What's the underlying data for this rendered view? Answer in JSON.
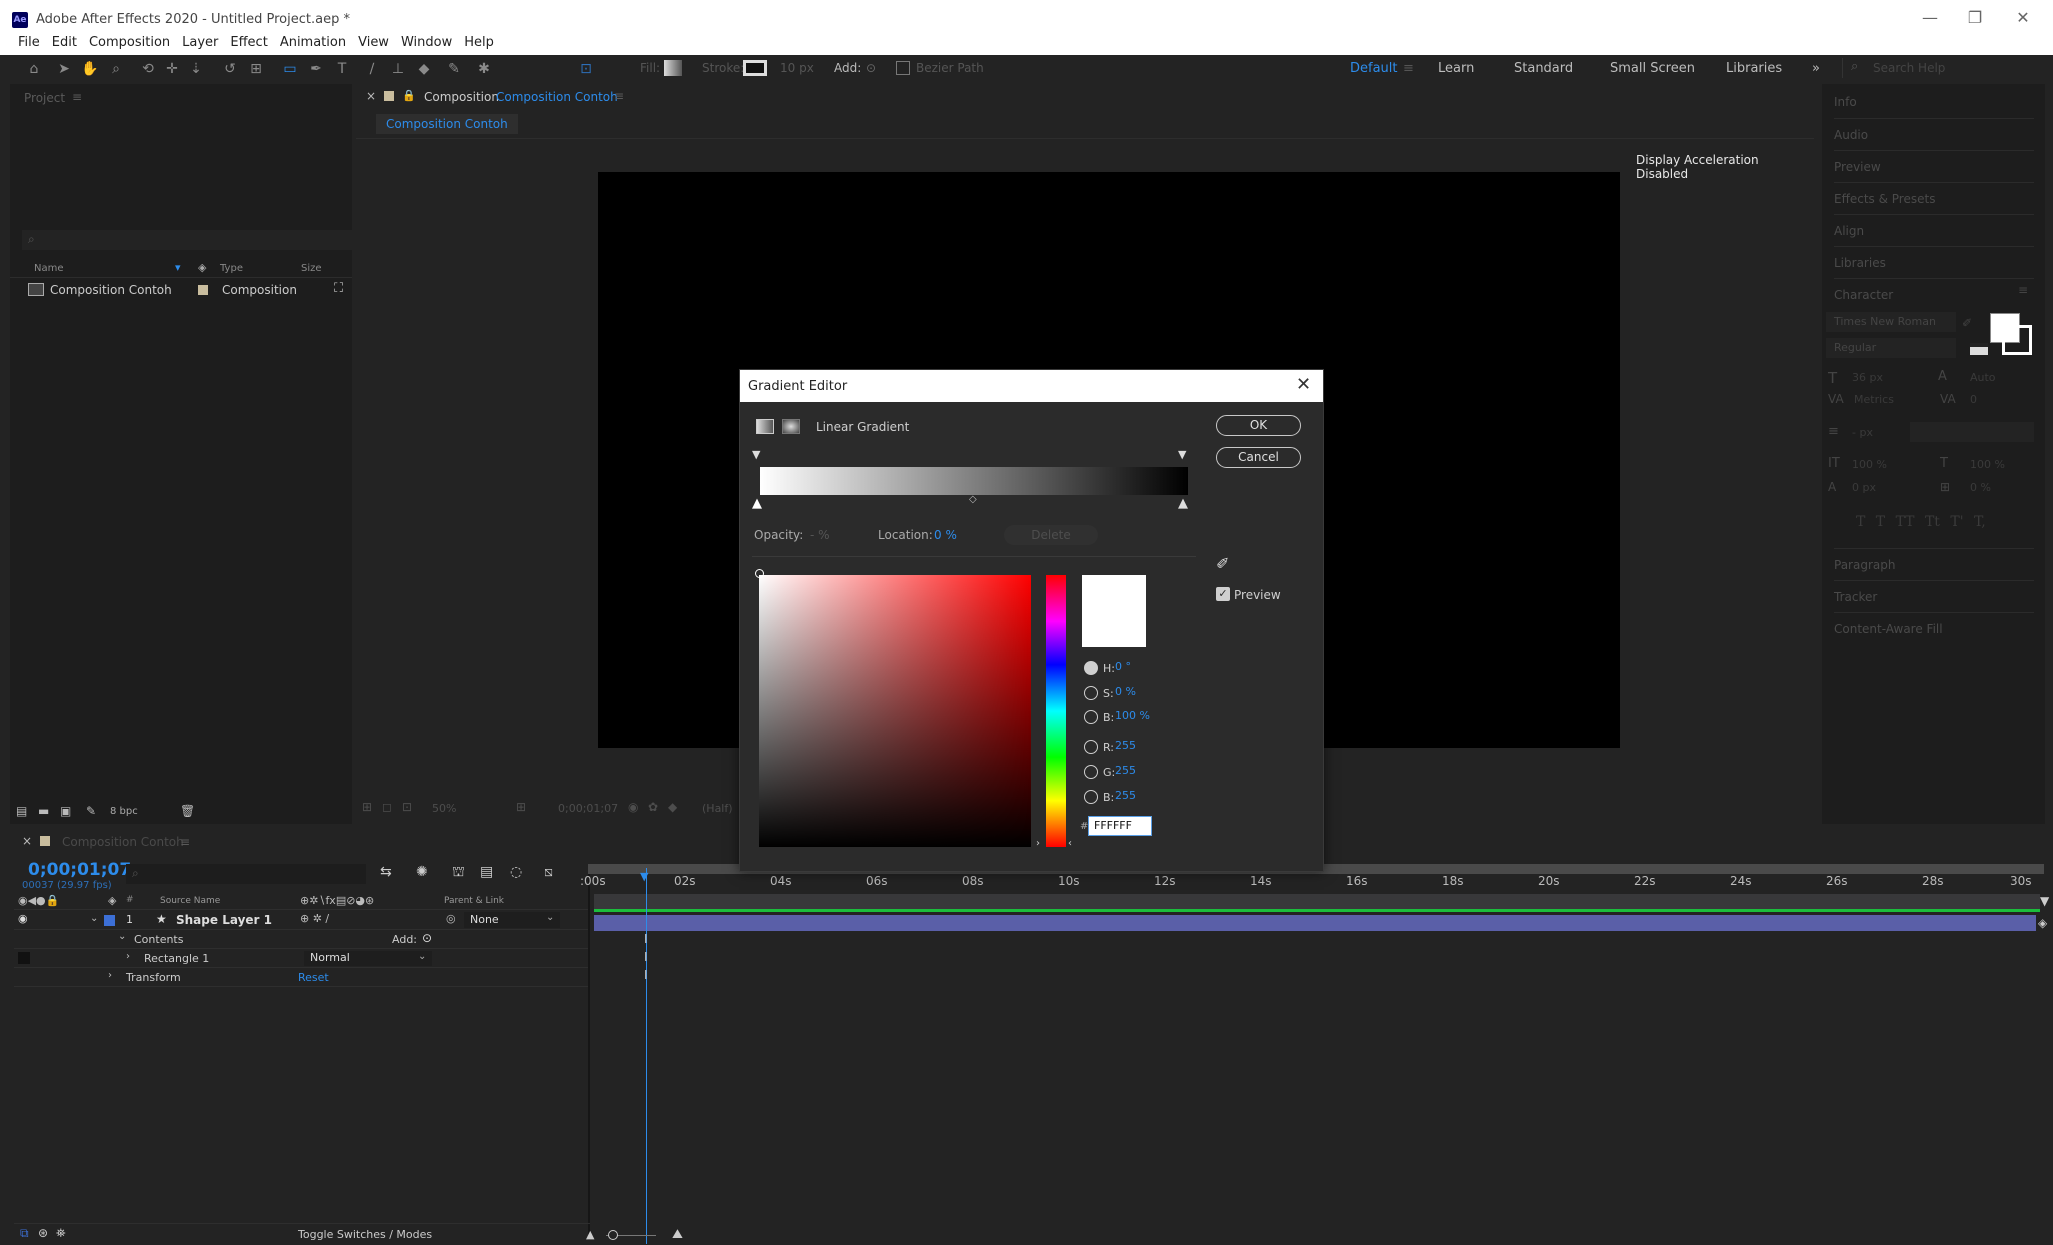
{
  "app": {
    "icon_text": "Ae",
    "title": "Adobe After Effects 2020 - Untitled Project.aep *"
  },
  "menu": [
    "File",
    "Edit",
    "Composition",
    "Layer",
    "Effect",
    "Animation",
    "View",
    "Window",
    "Help"
  ],
  "toolbar": {
    "fill_label": "Fill:",
    "stroke_label": "Stroke:",
    "stroke_width": "10 px",
    "add_label": "Add:",
    "bezier_label": "Bezier Path",
    "search_placeholder": "Search Help"
  },
  "workspaces": {
    "items": [
      "Default",
      "Learn",
      "Standard",
      "Small Screen",
      "Libraries"
    ],
    "active": "Default"
  },
  "project": {
    "title": "Project",
    "columns": [
      "Name",
      "Type",
      "Size"
    ],
    "item_name": "Composition Contoh",
    "item_type": "Composition",
    "bpc": "8 bpc"
  },
  "composition": {
    "tab_prefix": "Composition",
    "tab_name": "Composition Contoh",
    "subtab": "Composition Contoh",
    "notice": "Display Acceleration Disabled",
    "zoom": "50%",
    "timecode": "0;00;01;07",
    "resolution": "(Half)"
  },
  "right_panels": [
    "Info",
    "Audio",
    "Preview",
    "Effects & Presets",
    "Align",
    "Libraries",
    "Character",
    "Paragraph",
    "Tracker",
    "Content-Aware Fill"
  ],
  "character": {
    "font": "Times New Roman",
    "style": "Regular",
    "size": "36 px",
    "leading": "Auto",
    "kerning": "Metrics",
    "tracking": "0",
    "stroke_width": "- px",
    "vscale": "100 %",
    "hscale": "100 %",
    "baseline": "0 px",
    "tsume": "0 %",
    "styles": "T T TT Tt T' T,"
  },
  "gradient_editor": {
    "title": "Gradient Editor",
    "type_label": "Linear Gradient",
    "ok": "OK",
    "cancel": "Cancel",
    "opacity_label": "Opacity:",
    "opacity_value": "- %",
    "location_label": "Location:",
    "location_value": "0 %",
    "delete": "Delete",
    "preview_label": "Preview",
    "h_label": "H:",
    "h_value": "0 °",
    "s_label": "S:",
    "s_value": "0 %",
    "b_label": "B:",
    "b_value": "100 %",
    "r_label": "R:",
    "r_value": "255",
    "g_label": "G:",
    "g_value": "255",
    "bl_label": "B:",
    "bl_value": "255",
    "hex": "FFFFFF"
  },
  "timeline": {
    "comp_tab": "Composition Contoh",
    "timecode": "0;00;01;07",
    "frame_info": "00037 (29.97 fps)",
    "cols_source": "Source Name",
    "cols_parent": "Parent & Link",
    "layer_index": "1",
    "layer_name": "Shape Layer 1",
    "parent_value": "None",
    "contents": "Contents",
    "add_label": "Add:",
    "rect": "Rectangle 1",
    "blend": "Normal",
    "transform": "Transform",
    "reset": "Reset",
    "toggle": "Toggle Switches / Modes",
    "ticks": [
      ":00s",
      "02s",
      "04s",
      "06s",
      "08s",
      "10s",
      "12s",
      "14s",
      "16s",
      "18s",
      "20s",
      "22s",
      "24s",
      "26s",
      "28s",
      "30s"
    ]
  }
}
